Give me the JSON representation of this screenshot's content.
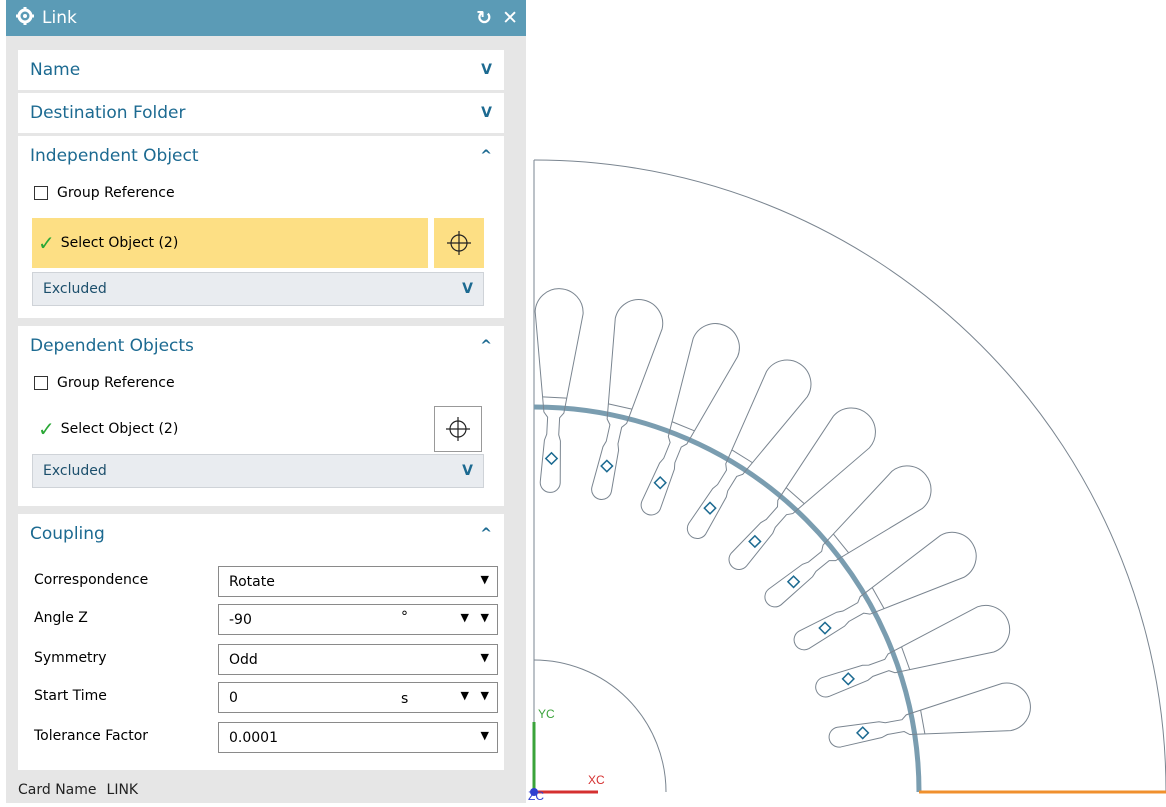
{
  "dialog": {
    "title": "Link",
    "sections": {
      "name": {
        "label": "Name"
      },
      "destination": {
        "label": "Destination Folder"
      },
      "independent": {
        "label": "Independent Object",
        "group_reference": "Group Reference",
        "select_object": "Select Object (2)",
        "excluded": "Excluded"
      },
      "dependent": {
        "label": "Dependent Objects",
        "group_reference": "Group Reference",
        "select_object": "Select Object (2)",
        "excluded": "Excluded"
      },
      "coupling": {
        "label": "Coupling",
        "correspondence": {
          "label": "Correspondence",
          "value": "Rotate"
        },
        "angle_z": {
          "label": "Angle Z",
          "value": "-90",
          "unit": "°"
        },
        "symmetry": {
          "label": "Symmetry",
          "value": "Odd"
        },
        "start_time": {
          "label": "Start Time",
          "value": "0",
          "unit": "s"
        },
        "tolerance": {
          "label": "Tolerance Factor",
          "value": "0.0001"
        }
      }
    },
    "footer": {
      "label": "Card Name",
      "value": "LINK"
    }
  },
  "viewport": {
    "triad": {
      "y_label": "YC",
      "x_label": "XC",
      "z_label": "ZC"
    }
  },
  "colors": {
    "title_bar": "#5b9bb6",
    "accent": "#1c6a91",
    "highlight": "#fddf84",
    "check": "#2aa836"
  }
}
